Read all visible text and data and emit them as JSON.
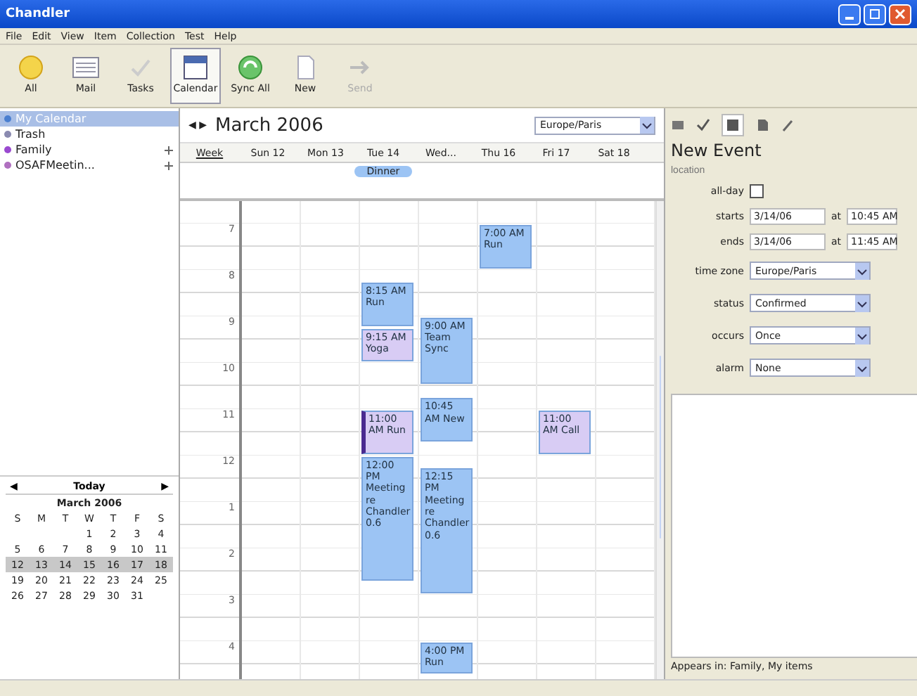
{
  "window": {
    "title": "Chandler"
  },
  "menu": [
    "File",
    "Edit",
    "View",
    "Item",
    "Collection",
    "Test",
    "Help"
  ],
  "toolbar": [
    {
      "label": "All",
      "kind": "all",
      "selected": false,
      "disabled": false
    },
    {
      "label": "Mail",
      "kind": "mail",
      "selected": false,
      "disabled": false
    },
    {
      "label": "Tasks",
      "kind": "tasks",
      "selected": false,
      "disabled": false
    },
    {
      "label": "Calendar",
      "kind": "calendar",
      "selected": true,
      "disabled": false
    },
    {
      "label": "Sync All",
      "kind": "sync",
      "selected": false,
      "disabled": false
    },
    {
      "label": "New",
      "kind": "new",
      "selected": false,
      "disabled": false
    },
    {
      "label": "Send",
      "kind": "send",
      "selected": false,
      "disabled": true
    }
  ],
  "sidebar": {
    "items": [
      {
        "label": "My Calendar",
        "selected": true,
        "color": "#4a7fd0",
        "shared": false
      },
      {
        "label": "Trash",
        "selected": false,
        "color": "#8a8ab0",
        "shared": false
      },
      {
        "label": "Family",
        "selected": false,
        "color": "#9a4ad0",
        "shared": true
      },
      {
        "label": "OSAFMeetin...",
        "selected": false,
        "color": "#b070c0",
        "shared": true
      }
    ]
  },
  "minical": {
    "prev": "◀",
    "today": "Today",
    "next": "▶",
    "month": "March 2006",
    "weekdays": [
      "S",
      "M",
      "T",
      "W",
      "T",
      "F",
      "S"
    ],
    "weeks": [
      {
        "selected": false,
        "days": [
          "1",
          "2",
          "3",
          "4"
        ]
      },
      {
        "selected": false,
        "days": [
          "5",
          "6",
          "7",
          "8",
          "9",
          "10",
          "11"
        ]
      },
      {
        "selected": true,
        "days": [
          "12",
          "13",
          "14",
          "15",
          "16",
          "17",
          "18"
        ]
      },
      {
        "selected": false,
        "days": [
          "19",
          "20",
          "21",
          "22",
          "23",
          "24",
          "25"
        ]
      },
      {
        "selected": false,
        "days": [
          "26",
          "27",
          "28",
          "29",
          "30",
          "31"
        ]
      }
    ]
  },
  "calendar": {
    "nav": "◀ ▶",
    "month": "March 2006",
    "timezone": "Europe/Paris",
    "week_label": "Week",
    "hours": [
      "7",
      "8",
      "9",
      "10",
      "11",
      "12",
      "1",
      "2",
      "3",
      "4"
    ],
    "days": [
      {
        "label": "Sun 12"
      },
      {
        "label": "Mon 13"
      },
      {
        "label": "Tue 14",
        "all_day": [
          "Dinner"
        ],
        "events": [
          {
            "time": "8:15 AM",
            "title": "Run",
            "kind": "hour",
            "color": "#9cc4f4",
            "selected": false
          },
          {
            "time": "9:15 AM",
            "title": "Yoga",
            "kind": "short",
            "color": "#d8ccf4",
            "selected": false
          },
          {
            "time": "11:00 AM",
            "title": "Run",
            "kind": "hour",
            "color": "#d8ccf4",
            "selected": true
          },
          {
            "time": "12:00 PM",
            "title": "Meeting re Chandler 0.6",
            "kind": "long",
            "color": "#9cc4f4",
            "selected": false
          }
        ]
      },
      {
        "label": "Wed...",
        "events": [
          {
            "time": "9:00 AM",
            "title": "Team Sync",
            "kind": "medium",
            "color": "#9cc4f4",
            "selected": false
          },
          {
            "time": "10:45 AM",
            "title": "New",
            "kind": "hour",
            "color": "#9cc4f4",
            "selected": false
          },
          {
            "time": "12:15 PM",
            "title": "Meeting re Chandler 0.6",
            "kind": "long",
            "color": "#9cc4f4",
            "selected": false
          },
          {
            "time": "4:00 PM",
            "title": "Run",
            "kind": "short",
            "color": "#9cc4f4",
            "selected": false
          }
        ]
      },
      {
        "label": "Thu 16",
        "events": [
          {
            "time": "7:00 AM",
            "title": "Run",
            "kind": "hour",
            "color": "#9cc4f4",
            "selected": false
          }
        ]
      },
      {
        "label": "Fri 17",
        "events": [
          {
            "time": "11:00 AM",
            "title": "Call",
            "kind": "hour",
            "color": "#d8ccf4",
            "selected": false
          }
        ]
      },
      {
        "label": "Sat 18"
      }
    ]
  },
  "detail": {
    "title": "New Event",
    "location": {
      "placeholder": "location"
    },
    "all_day": {
      "label": "all-day",
      "checked": false
    },
    "starts": {
      "label": "starts",
      "date": "3/14/06",
      "at": "at",
      "time": "10:45 AM"
    },
    "ends": {
      "label": "ends",
      "date": "3/14/06",
      "at": "at",
      "time": "11:45 AM"
    },
    "selects": [
      {
        "label": "time zone",
        "value": "Europe/Paris"
      },
      {
        "label": "status",
        "value": "Confirmed"
      },
      {
        "label": "occurs",
        "value": "Once"
      },
      {
        "label": "alarm",
        "value": "None"
      }
    ],
    "appears_in": "Appears in: Family, My items"
  }
}
